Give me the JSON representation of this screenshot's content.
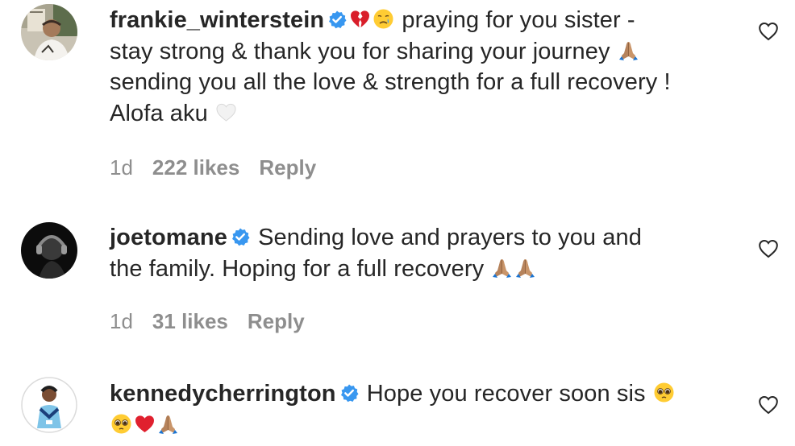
{
  "comments": [
    {
      "username": "frankie_winterstein",
      "verified": true,
      "text_lines": [
        "praying for you sister -",
        "stay strong & thank you for sharing your journey",
        "sending you all the love & strength for a full recovery !",
        "Alofa aku"
      ],
      "time": "1d",
      "likes": "222 likes",
      "reply": "Reply"
    },
    {
      "username": "joetomane",
      "verified": true,
      "text_lines": [
        "Sending love and prayers to you and",
        "the family. Hoping for a full recovery"
      ],
      "time": "1d",
      "likes": "31 likes",
      "reply": "Reply"
    },
    {
      "username": "kennedycherrington",
      "verified": true,
      "text_lines": [
        "Hope you recover soon sis"
      ]
    }
  ],
  "icons": {
    "verified": "verified-badge-icon",
    "like": "heart-outline-icon",
    "accent": "#3897f0",
    "broken_heart": "#d91e2a",
    "red_heart": "#e0202e"
  }
}
